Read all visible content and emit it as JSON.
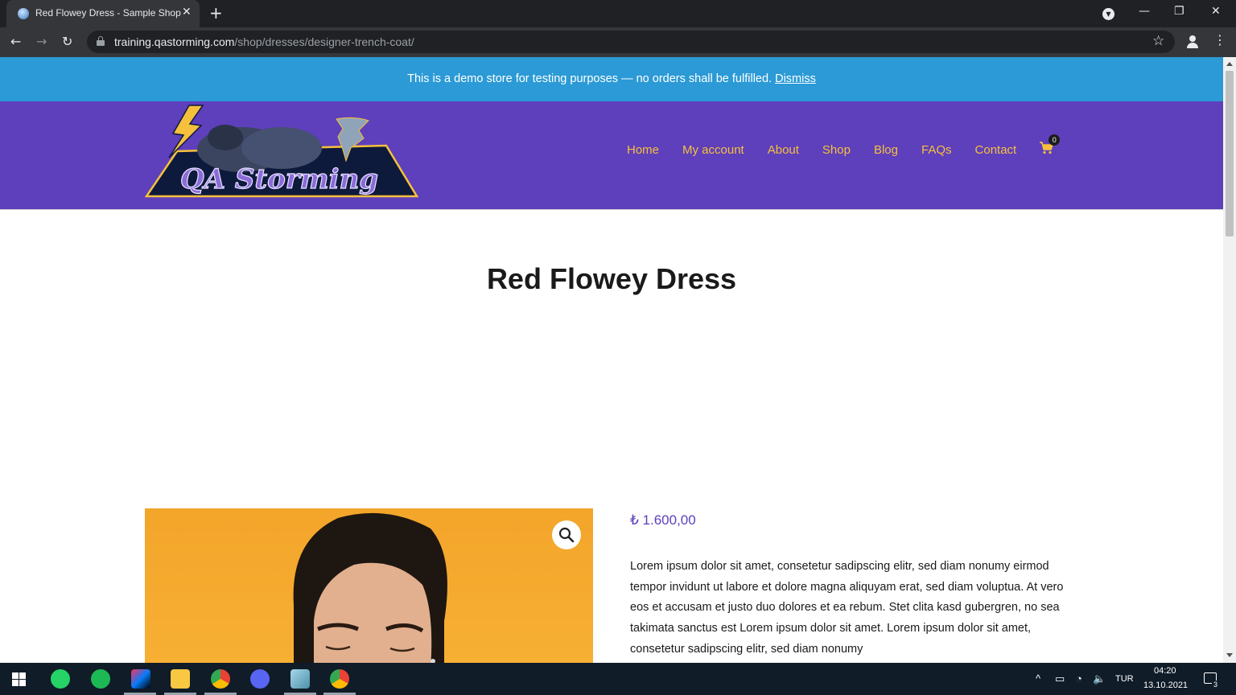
{
  "browser": {
    "tab_title": "Red Flowey Dress - Sample Shop",
    "tab_close": "✕",
    "new_tab": "+",
    "url_host": "training.qastorming.com",
    "url_path": "/shop/dresses/designer-trench-coat/",
    "window_controls": {
      "minimize": "—",
      "restore": "❐",
      "close": "✕"
    }
  },
  "demo_notice": {
    "text": "This is a demo store for testing purposes — no orders shall be fulfilled.",
    "dismiss": "Dismiss"
  },
  "header": {
    "logo_text": "QA Storming",
    "nav": [
      "Home",
      "My account",
      "About",
      "Shop",
      "Blog",
      "FAQs",
      "Contact"
    ],
    "cart_count": "0"
  },
  "product": {
    "title": "Red Flowey Dress",
    "price": "₺ 1.600,00",
    "description": "Lorem ipsum dolor sit amet, consetetur sadipscing elitr, sed diam nonumy eirmod tempor invidunt ut labore et dolore magna aliquyam erat, sed diam voluptua. At vero eos et accusam et justo duo dolores et ea rebum. Stet clita kasd gubergren, no sea takimata sanctus est Lorem ipsum dolor sit amet. Lorem ipsum dolor sit amet, consetetur sadipscing elitr, sed diam nonumy"
  },
  "taskbar": {
    "apps": [
      "whatsapp-icon",
      "spotify-icon",
      "intellij-icon",
      "file-explorer-icon",
      "chrome-icon",
      "discord-icon",
      "notepad-icon",
      "chrome-active-icon"
    ],
    "language": "TUR",
    "time": "04:20",
    "date": "13.10.2021",
    "notification_count": "3"
  },
  "colors": {
    "demo_bar": "#2b9ad6",
    "header_bg": "#5e3fbc",
    "nav_text": "#f5c13c",
    "price": "#5e3fbc",
    "image_bg": "#f3a52a"
  }
}
